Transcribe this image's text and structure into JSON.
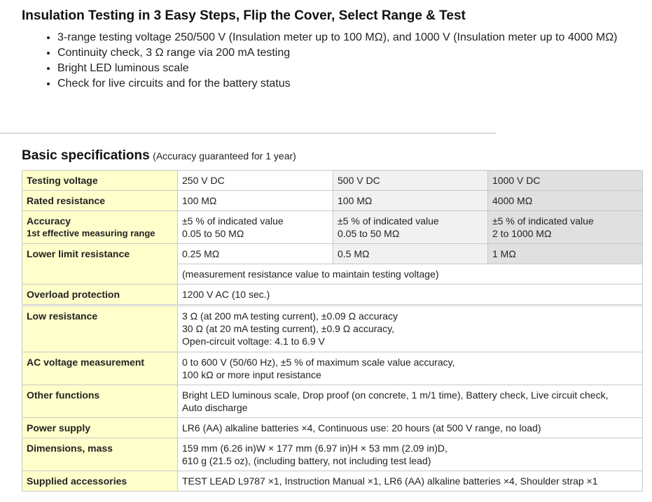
{
  "heading": "Insulation Testing in 3 Easy Steps, Flip the Cover, Select Range & Test",
  "bullets": [
    "3-range testing voltage 250/500 V (Insulation meter up to 100 MΩ), and 1000 V (Insulation meter up to 4000 MΩ)",
    "Continuity check, 3 Ω range via 200 mA testing",
    "Bright LED luminous scale",
    "Check for live circuits and for the battery status"
  ],
  "specs": {
    "title": "Basic specifications",
    "note": "(Accuracy guaranteed for 1 year)",
    "testing_voltage": {
      "label": "Testing voltage",
      "v250": "250 V DC",
      "v500": "500 V DC",
      "v1000": "1000 V DC"
    },
    "rated_resistance": {
      "label": "Rated resistance",
      "v250": "100 MΩ",
      "v500": "100 MΩ",
      "v1000": "4000 MΩ"
    },
    "accuracy": {
      "label": "Accuracy",
      "sublabel": "1st effective measuring range",
      "v250": [
        "±5 % of indicated value",
        "0.05 to 50 MΩ"
      ],
      "v500": [
        "±5 % of indicated value",
        "0.05 to 50 MΩ"
      ],
      "v1000": [
        "±5 % of indicated value",
        "2 to 1000 MΩ"
      ]
    },
    "lower_limit": {
      "label": "Lower limit resistance",
      "v250": "0.25 MΩ",
      "v500": "0.5 MΩ",
      "v1000": "1 MΩ",
      "note": "(measurement resistance value to maintain testing voltage)"
    },
    "overload": {
      "label": "Overload protection",
      "value": "1200 V AC (10 sec.)"
    },
    "low_resistance": {
      "label": "Low resistance",
      "lines": [
        "3 Ω (at 200 mA testing current), ±0.09 Ω accuracy",
        "30 Ω (at 20 mA testing current), ±0.9 Ω accuracy,",
        "Open-circuit voltage: 4.1 to 6.9 V"
      ]
    },
    "ac_voltage": {
      "label": "AC voltage measurement",
      "lines": [
        "0 to 600 V (50/60 Hz), ±5 % of maximum scale value accuracy,",
        "100 kΩ or more input resistance"
      ]
    },
    "other_functions": {
      "label": "Other functions",
      "lines": [
        "Bright LED luminous scale, Drop proof (on concrete, 1 m/1 time), Battery check, Live circuit check,",
        "Auto discharge"
      ]
    },
    "power_supply": {
      "label": "Power supply",
      "value": "LR6 (AA) alkaline batteries ×4, Continuous use: 20 hours (at 500 V range, no load)"
    },
    "dimensions": {
      "label": "Dimensions, mass",
      "lines": [
        "159 mm (6.26 in)W × 177 mm (6.97 in)H × 53 mm (2.09 in)D,",
        "610 g (21.5 oz), (including battery, not including test lead)"
      ]
    },
    "accessories": {
      "label": "Supplied accessories",
      "value": "TEST LEAD L9787 ×1, Instruction Manual ×1, LR6 (AA) alkaline batteries ×4, Shoulder strap ×1"
    }
  },
  "colors": {
    "label_bg": "#ffffcc",
    "label_text": "#1a3a6c",
    "col3_bg": "#f1f1f1",
    "col4_bg": "#e0e0e0",
    "border": "#c8c8c8"
  }
}
